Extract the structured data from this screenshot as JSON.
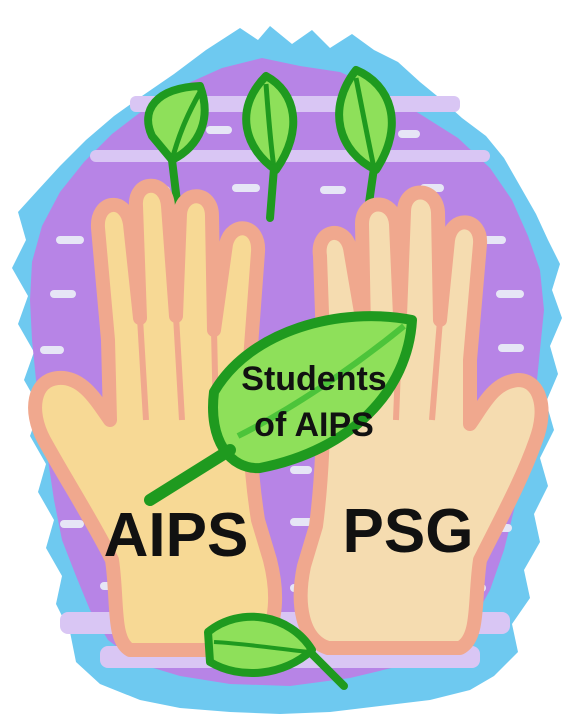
{
  "labels": {
    "left_hand": "AIPS",
    "right_hand": "PSG",
    "leaf_line1": "Students",
    "leaf_line2": "of AIPS"
  },
  "colors": {
    "sky": "#6ec9f0",
    "purple": "#b784e6",
    "stripe": "#d9c6f4",
    "cloud": "#e6e6f6",
    "hand_fill": "#f7d995",
    "hand_outline": "#f0a88e",
    "hand_right_fill": "#f5dcb0",
    "leaf_dark": "#1f9a1f",
    "leaf_light": "#8ee05a",
    "leaf_mid": "#4cc43a",
    "text": "#111111"
  },
  "icons": [
    "hands-icon",
    "leaf-icon"
  ]
}
